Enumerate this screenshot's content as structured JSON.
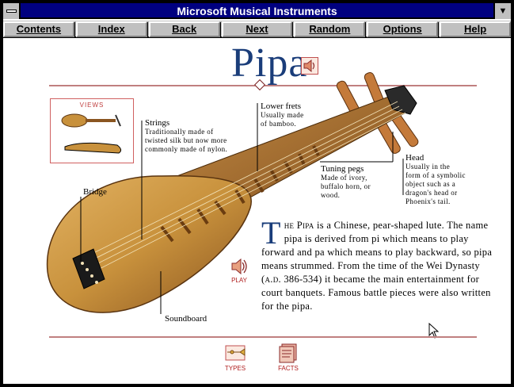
{
  "window": {
    "title": "Microsoft Musical Instruments"
  },
  "toolbar": {
    "items": [
      "Contents",
      "Index",
      "Back",
      "Next",
      "Random",
      "Options",
      "Help"
    ]
  },
  "page": {
    "title": "Pipa"
  },
  "views": {
    "label": "VIEWS"
  },
  "callouts": {
    "strings": {
      "title": "Strings",
      "desc": [
        "Traditionally made of",
        "twisted silk but now more",
        "commonly made of nylon."
      ]
    },
    "lower_frets": {
      "title": "Lower frets",
      "desc": [
        "Usually made",
        "of bamboo."
      ]
    },
    "head": {
      "title": "Head",
      "desc": [
        "Usually in the",
        "form of a symbolic",
        "object such as a",
        "dragon's head or",
        "Phoenix's tail."
      ]
    },
    "tuning_pegs": {
      "title": "Tuning pegs",
      "desc": [
        "Made of ivory,",
        "buffalo horn, or",
        "wood."
      ]
    },
    "bridge": {
      "title": "Bridge"
    },
    "soundboard": {
      "title": "Soundboard"
    }
  },
  "article": {
    "dropcap": "T",
    "lead_smallcaps": "he Pipa",
    "text_1": " is a Chinese, pear-shaped lute. The name pipa is derived from pi which means to play forward and pa which means to play backward, so pipa means strummed. From the time of the Wei Dynasty (",
    "era": "a.d.",
    "text_2": " 386-534) it became the main entertainment for court banquets. Famous battle pieces were also written for the pipa."
  },
  "buttons": {
    "play": "PLAY",
    "types": "TYPES",
    "facts": "FACTS"
  },
  "colors": {
    "title_bar": "#000080",
    "heading": "#1a3d7a",
    "accent_red": "#b02020",
    "rule": "#c08080",
    "wood": "#c8913c"
  },
  "icons": {
    "system_menu": "system-menu-icon",
    "maximize": "maximize-arrow-icon",
    "speaker": "speaker-icon",
    "cursor": "arrow-cursor-icon"
  }
}
